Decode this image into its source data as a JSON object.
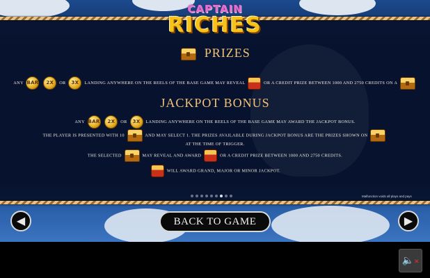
{
  "logo": {
    "line1": "CAPTAIN",
    "line2": "RICHES"
  },
  "prizes": {
    "title": "PRIZES",
    "text_any": "ANY",
    "text_or": "OR",
    "text_middle": "LANDING ANYWHERE ON THE REELS OF THE BASE GAME MAY REVEAL",
    "text_end": "OR A CREDIT PRIZE BETWEEN 1000 AND 2750 CREDITS ON A"
  },
  "jackpot": {
    "title": "JACKPOT BONUS",
    "line1_any": "ANY",
    "line1_or": "OR",
    "line1_rest": "LANDING ANYWHERE ON THE REELS OF THE BASE GAME MAY AWARD THE JACKPOT BONUS.",
    "line2_a": "THE PLAYER IS PRESENTED WITH 10",
    "line2_b": "AND MAY SELECT 1. THE PRIZES AVAILABLE DURING JACKPOT BONUS ARE THE PRIZES SHOWN ON",
    "line3": "AT THE TIME OF TRIGGER.",
    "line4_a": "THE SELECTED",
    "line4_b": "MAY REVEAL AND AWARD",
    "line4_c": "OR A CREDIT PRIZE BETWEEN 1000 AND 2750 CREDITS.",
    "line5": "WILL AWARD GRAND, MAJOR OR MINOR JACKPOT."
  },
  "symbols": {
    "s1": "BAR",
    "s2": "2X",
    "s3": "3X"
  },
  "pagination": {
    "total": 9,
    "active": 7
  },
  "malfunction_note": "Malfunction voids all plays and pays",
  "nav": {
    "prev_icon": "arrow-left-icon",
    "next_icon": "arrow-right-icon",
    "prev_glyph": "◀",
    "next_glyph": "▶"
  },
  "back_button": "BACK TO GAME",
  "sound": {
    "icon": "speaker-muted-icon",
    "glyph": "🔈",
    "x": "✕"
  }
}
